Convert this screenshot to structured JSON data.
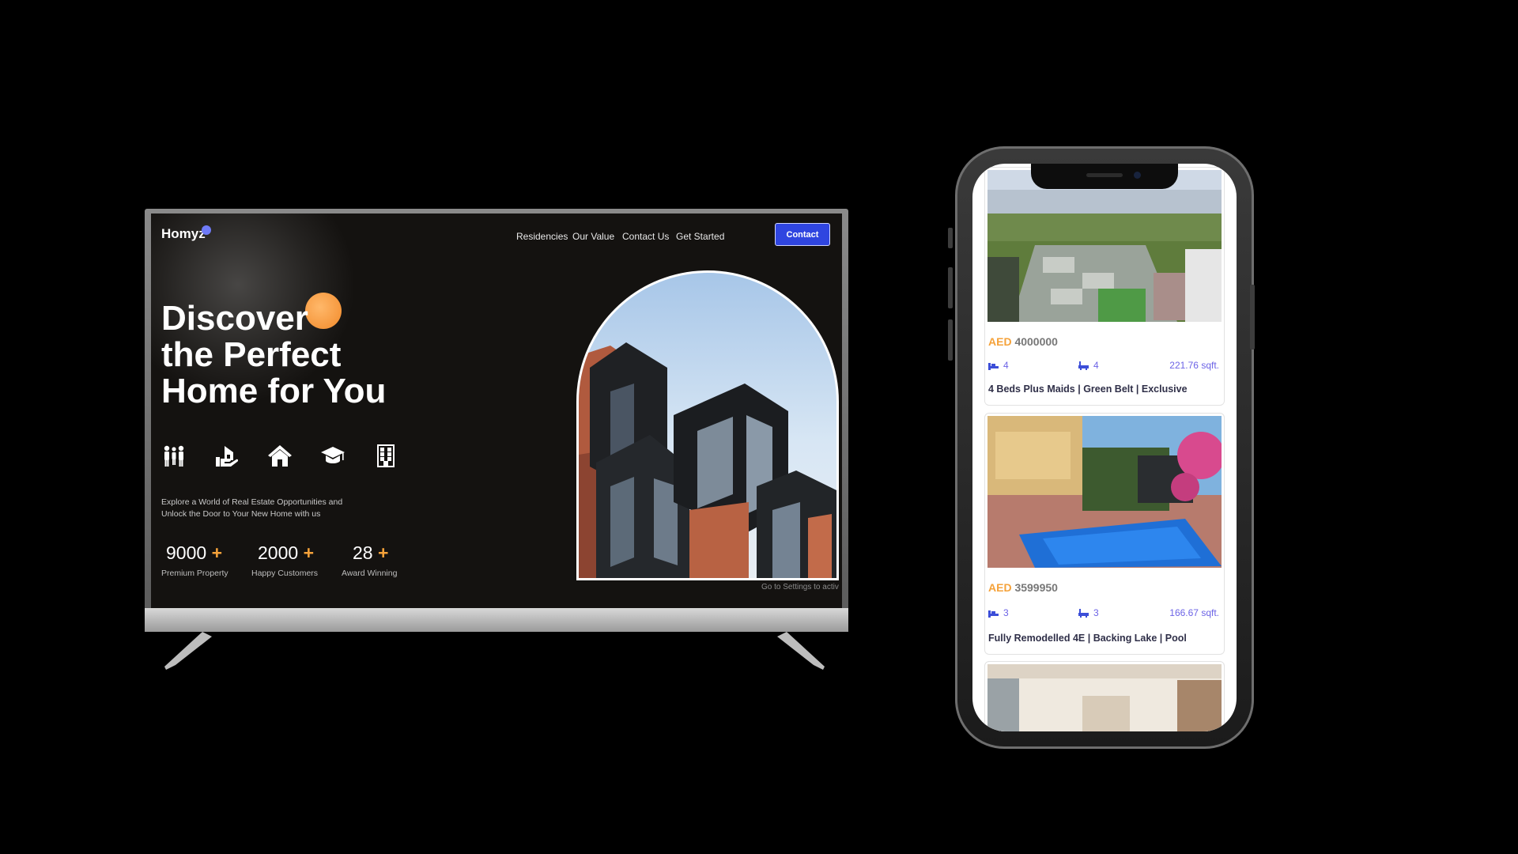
{
  "tv_site": {
    "logo": "Homyz",
    "nav": [
      "Residencies",
      "Our Value",
      "Contact Us",
      "Get Started"
    ],
    "contact_button": "Contact",
    "headline": [
      "Discover",
      "the Perfect",
      "Home for You"
    ],
    "feature_icons": [
      "family-icon",
      "house-hand-icon",
      "home-icon",
      "graduation-cap-icon",
      "building-icon"
    ],
    "subtitle": [
      "Explore a World of Real Estate Opportunities and",
      "Unlock the Door to Your New Home with us"
    ],
    "stats": [
      {
        "value": "9000",
        "plus": "+",
        "label": "Premium Property"
      },
      {
        "value": "2000",
        "plus": "+",
        "label": "Happy Customers"
      },
      {
        "value": "28",
        "plus": "+",
        "label": "Award Winning"
      }
    ],
    "activate_text": "Go to Settings to activ"
  },
  "phone_listings": [
    {
      "currency": "AED",
      "price": "4000000",
      "beds": "4",
      "baths": "4",
      "area": "221.76 sqft.",
      "title": "4 Beds Plus Maids | Green Belt | Exclusive"
    },
    {
      "currency": "AED",
      "price": "3599950",
      "beds": "3",
      "baths": "3",
      "area": "166.67 sqft.",
      "title": "Fully Remodelled 4E | Backing Lake | Pool"
    }
  ],
  "colors": {
    "accent_blue": "#2f45e0",
    "accent_orange": "#f5a23a",
    "meta_purple": "#6c63e6"
  }
}
